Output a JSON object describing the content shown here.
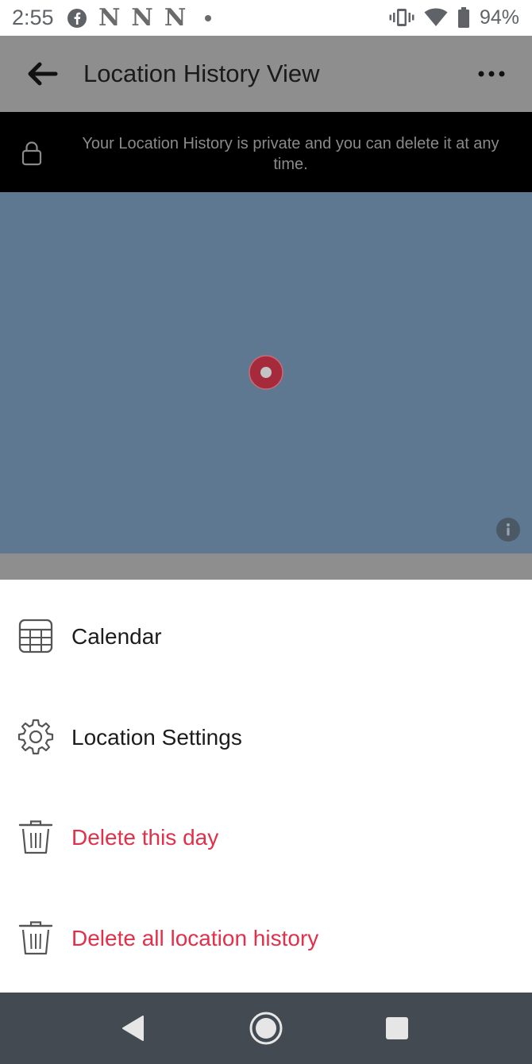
{
  "status_bar": {
    "time": "2:55",
    "notification_icons": [
      "facebook-icon",
      "netflix-icon",
      "netflix-icon",
      "netflix-icon",
      "dot-icon"
    ],
    "battery_percent": "94%"
  },
  "app_bar": {
    "title": "Location History View"
  },
  "privacy_banner": {
    "text": "Your Location History is private and you can delete it at any time."
  },
  "menu": {
    "items": [
      {
        "label": "Calendar",
        "icon": "calendar-icon",
        "color": "#1c1c1c"
      },
      {
        "label": "Location Settings",
        "icon": "gear-icon",
        "color": "#1c1c1c"
      },
      {
        "label": "Delete this day",
        "icon": "trash-icon",
        "color": "#e2304a"
      },
      {
        "label": "Delete all location history",
        "icon": "trash-icon",
        "color": "#e2304a"
      }
    ]
  },
  "colors": {
    "app_bar": "#8e8e8e",
    "map": "#5e7891",
    "marker": "#a52a3c",
    "danger": "#e2304a",
    "nav_bar": "#434a51"
  }
}
